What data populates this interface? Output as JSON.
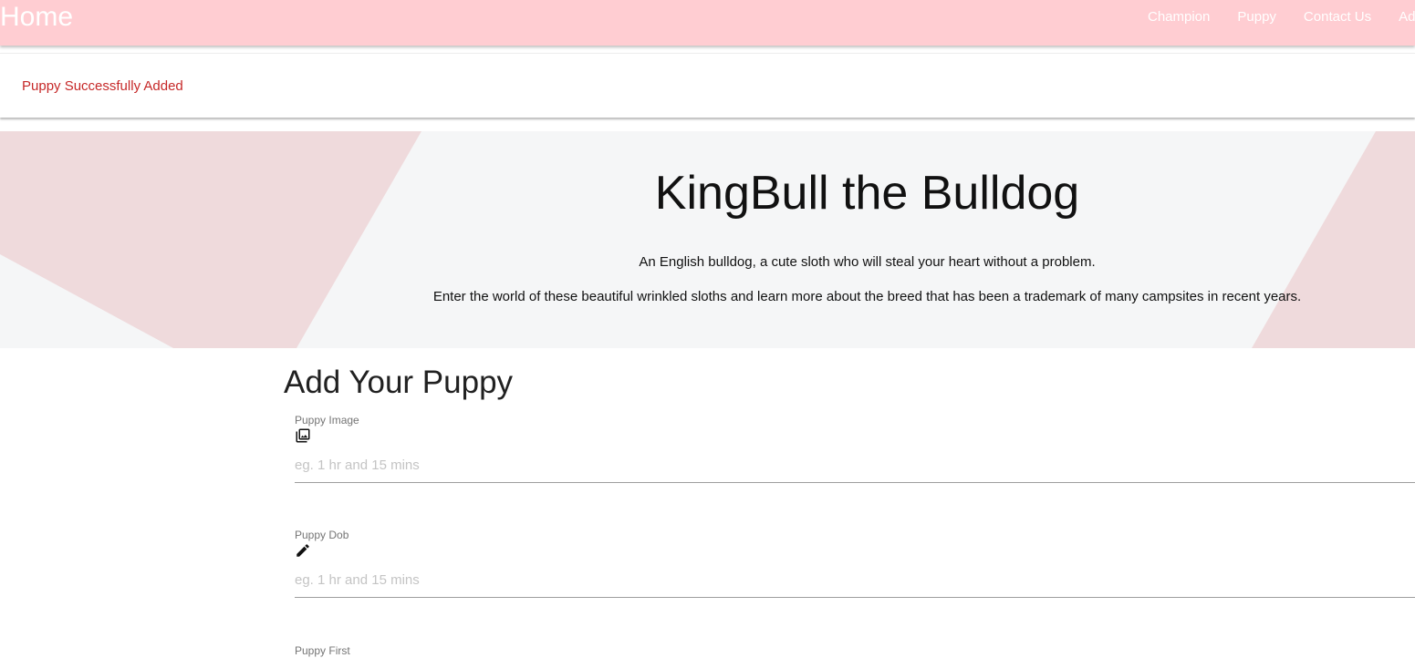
{
  "navbar": {
    "brand": "Home",
    "links": [
      "Champion",
      "Puppy",
      "Contact Us",
      "Ad"
    ]
  },
  "alert": {
    "message": "Puppy Successfully Added"
  },
  "hero": {
    "title": "KingBull the Bulldog",
    "line1": "An English bulldog, a cute sloth who will steal your heart without a problem.",
    "line2": "Enter the world of these beautiful wrinkled sloths and learn more about the breed that has been a trademark of many campsites in recent years."
  },
  "form": {
    "title": "Add Your Puppy",
    "fields": [
      {
        "label": "Puppy Image",
        "icon": "image-collection-icon",
        "placeholder": "eg. 1 hr and 15 mins"
      },
      {
        "label": "Puppy Dob",
        "icon": "pencil-icon",
        "placeholder": "eg. 1 hr and 15 mins"
      },
      {
        "label": "Puppy First",
        "icon": "",
        "placeholder": ""
      }
    ]
  },
  "colors": {
    "navbar_bg": "#ffcdd2",
    "alert_text": "#c62828",
    "hero_bg": "#f5f6f7",
    "hero_accent": "#efdadc"
  }
}
